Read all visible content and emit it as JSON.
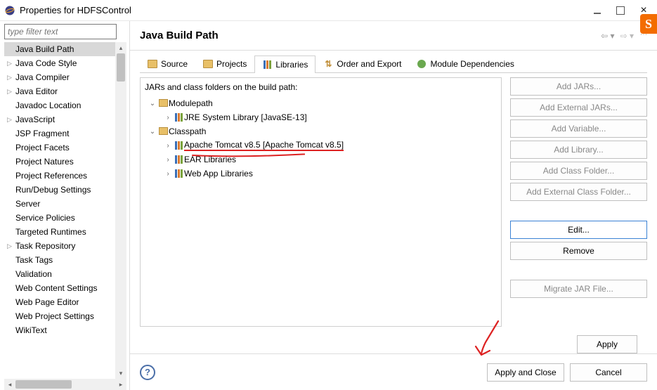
{
  "titlebar": {
    "title": "Properties for HDFSControl"
  },
  "filter": {
    "placeholder": "type filter text"
  },
  "sidebar": {
    "items": [
      {
        "label": "Java Build Path",
        "selected": true,
        "expandable": false
      },
      {
        "label": "Java Code Style",
        "expandable": true
      },
      {
        "label": "Java Compiler",
        "expandable": true
      },
      {
        "label": "Java Editor",
        "expandable": true
      },
      {
        "label": "Javadoc Location",
        "expandable": false
      },
      {
        "label": "JavaScript",
        "expandable": true
      },
      {
        "label": "JSP Fragment",
        "expandable": false
      },
      {
        "label": "Project Facets",
        "expandable": false
      },
      {
        "label": "Project Natures",
        "expandable": false
      },
      {
        "label": "Project References",
        "expandable": false
      },
      {
        "label": "Run/Debug Settings",
        "expandable": false
      },
      {
        "label": "Server",
        "expandable": false
      },
      {
        "label": "Service Policies",
        "expandable": false
      },
      {
        "label": "Targeted Runtimes",
        "expandable": false
      },
      {
        "label": "Task Repository",
        "expandable": true
      },
      {
        "label": "Task Tags",
        "expandable": false
      },
      {
        "label": "Validation",
        "expandable": false
      },
      {
        "label": "Web Content Settings",
        "expandable": false
      },
      {
        "label": "Web Page Editor",
        "expandable": false
      },
      {
        "label": "Web Project Settings",
        "expandable": false
      },
      {
        "label": "WikiText",
        "expandable": false
      }
    ]
  },
  "header": {
    "title": "Java Build Path"
  },
  "tabs": [
    {
      "label": "Source",
      "icon": "src"
    },
    {
      "label": "Projects",
      "icon": "proj"
    },
    {
      "label": "Libraries",
      "icon": "lib",
      "active": true
    },
    {
      "label": "Order and Export",
      "icon": "ord"
    },
    {
      "label": "Module Dependencies",
      "icon": "mod"
    }
  ],
  "libraries": {
    "intro": "JARs and class folders on the build path:",
    "tree": [
      {
        "label": "Modulepath",
        "depth": 0,
        "expanded": true,
        "icon": "pkg"
      },
      {
        "label": "JRE System Library [JavaSE-13]",
        "depth": 1,
        "expanded": false,
        "icon": "books"
      },
      {
        "label": "Classpath",
        "depth": 0,
        "expanded": true,
        "icon": "pkg"
      },
      {
        "label": "Apache Tomcat v8.5 [Apache Tomcat v8.5]",
        "depth": 1,
        "expanded": false,
        "icon": "books",
        "highlighted": true
      },
      {
        "label": "EAR Libraries",
        "depth": 1,
        "expanded": false,
        "icon": "books"
      },
      {
        "label": "Web App Libraries",
        "depth": 1,
        "expanded": false,
        "icon": "books"
      }
    ]
  },
  "buttons": {
    "add_jars": "Add JARs...",
    "add_ext_jars": "Add External JARs...",
    "add_var": "Add Variable...",
    "add_lib": "Add Library...",
    "add_class": "Add Class Folder...",
    "add_ext_class": "Add External Class Folder...",
    "edit": "Edit...",
    "remove": "Remove",
    "migrate": "Migrate JAR File...",
    "apply": "Apply",
    "apply_close": "Apply and Close",
    "cancel": "Cancel"
  }
}
